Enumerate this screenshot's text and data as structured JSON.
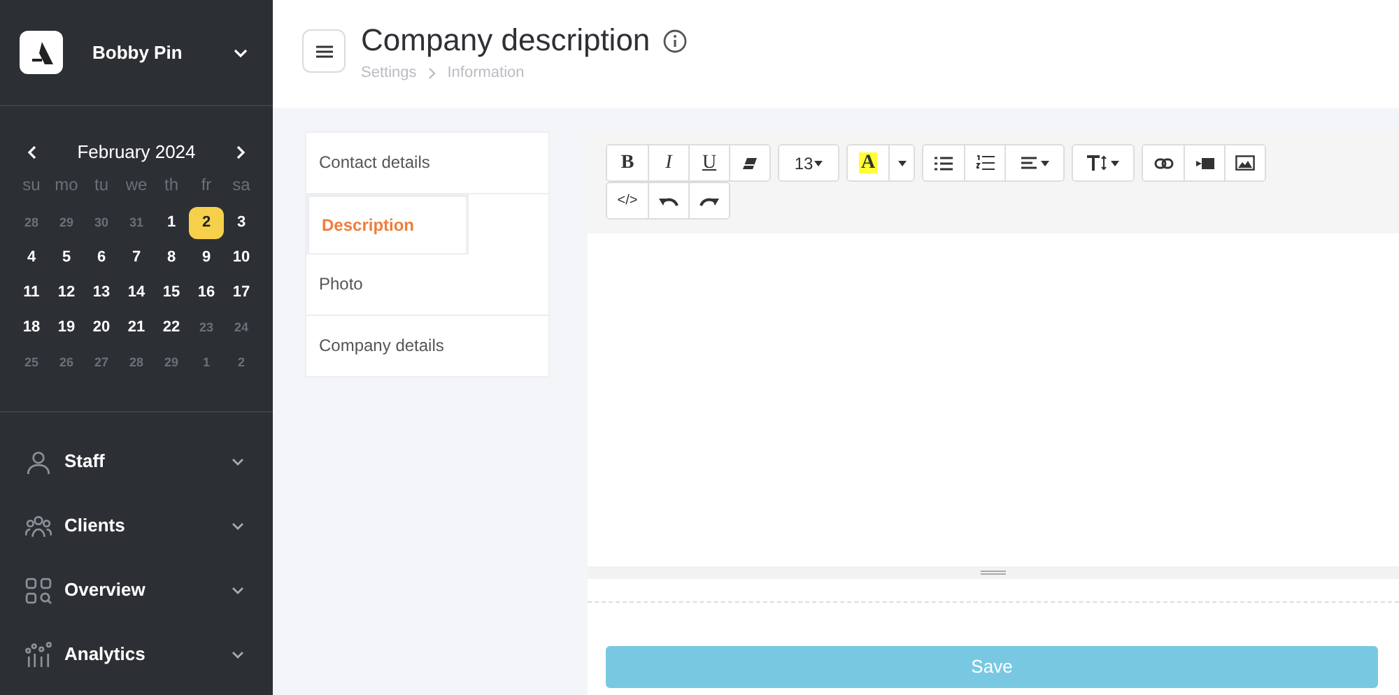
{
  "account": {
    "name": "Bobby Pin"
  },
  "calendar": {
    "month": "February 2024",
    "weekdays": [
      "su",
      "mo",
      "tu",
      "we",
      "th",
      "fr",
      "sa"
    ],
    "days": [
      {
        "label": "28",
        "muted": true,
        "selected": false
      },
      {
        "label": "29",
        "muted": true,
        "selected": false
      },
      {
        "label": "30",
        "muted": true,
        "selected": false
      },
      {
        "label": "31",
        "muted": true,
        "selected": false
      },
      {
        "label": "1",
        "muted": false,
        "selected": false
      },
      {
        "label": "2",
        "muted": false,
        "selected": true
      },
      {
        "label": "3",
        "muted": false,
        "selected": false
      },
      {
        "label": "4",
        "muted": false,
        "selected": false
      },
      {
        "label": "5",
        "muted": false,
        "selected": false
      },
      {
        "label": "6",
        "muted": false,
        "selected": false
      },
      {
        "label": "7",
        "muted": false,
        "selected": false
      },
      {
        "label": "8",
        "muted": false,
        "selected": false
      },
      {
        "label": "9",
        "muted": false,
        "selected": false
      },
      {
        "label": "10",
        "muted": false,
        "selected": false
      },
      {
        "label": "11",
        "muted": false,
        "selected": false
      },
      {
        "label": "12",
        "muted": false,
        "selected": false
      },
      {
        "label": "13",
        "muted": false,
        "selected": false
      },
      {
        "label": "14",
        "muted": false,
        "selected": false
      },
      {
        "label": "15",
        "muted": false,
        "selected": false
      },
      {
        "label": "16",
        "muted": false,
        "selected": false
      },
      {
        "label": "17",
        "muted": false,
        "selected": false
      },
      {
        "label": "18",
        "muted": false,
        "selected": false
      },
      {
        "label": "19",
        "muted": false,
        "selected": false
      },
      {
        "label": "20",
        "muted": false,
        "selected": false
      },
      {
        "label": "21",
        "muted": false,
        "selected": false
      },
      {
        "label": "22",
        "muted": false,
        "selected": false
      },
      {
        "label": "23",
        "muted": true,
        "selected": false
      },
      {
        "label": "24",
        "muted": true,
        "selected": false
      },
      {
        "label": "25",
        "muted": true,
        "selected": false
      },
      {
        "label": "26",
        "muted": true,
        "selected": false
      },
      {
        "label": "27",
        "muted": true,
        "selected": false
      },
      {
        "label": "28",
        "muted": true,
        "selected": false
      },
      {
        "label": "29",
        "muted": true,
        "selected": false
      },
      {
        "label": "1",
        "muted": true,
        "selected": false
      },
      {
        "label": "2",
        "muted": true,
        "selected": false
      }
    ]
  },
  "nav": [
    {
      "label": "Staff",
      "kind": "person"
    },
    {
      "label": "Clients",
      "kind": "group"
    },
    {
      "label": "Overview",
      "kind": "grid"
    },
    {
      "label": "Analytics",
      "kind": "chart"
    }
  ],
  "page": {
    "title": "Company description",
    "breadcrumb": [
      "Settings",
      "Information"
    ]
  },
  "tabs": [
    {
      "label": "Contact details",
      "selected": false
    },
    {
      "label": "Description",
      "selected": true
    },
    {
      "label": "Photo",
      "selected": false
    },
    {
      "label": "Company details",
      "selected": false
    }
  ],
  "toolbar": [
    [
      {
        "kind": "bold",
        "label": "B"
      },
      {
        "kind": "italic",
        "label": "I"
      },
      {
        "kind": "underline",
        "label": "U"
      },
      {
        "kind": "eraser"
      }
    ],
    [
      {
        "kind": "fontsize",
        "label": "13"
      }
    ],
    [
      {
        "kind": "highlight",
        "label": "A"
      },
      {
        "kind": "caret"
      }
    ],
    [
      {
        "kind": "ul"
      },
      {
        "kind": "ol"
      },
      {
        "kind": "align"
      }
    ],
    [
      {
        "kind": "lineheight"
      }
    ],
    [
      {
        "kind": "link"
      },
      {
        "kind": "video"
      },
      {
        "kind": "image"
      }
    ],
    [
      {
        "kind": "code",
        "label": "</>"
      },
      {
        "kind": "undo"
      },
      {
        "kind": "redo"
      }
    ]
  ],
  "save_button": "Save"
}
